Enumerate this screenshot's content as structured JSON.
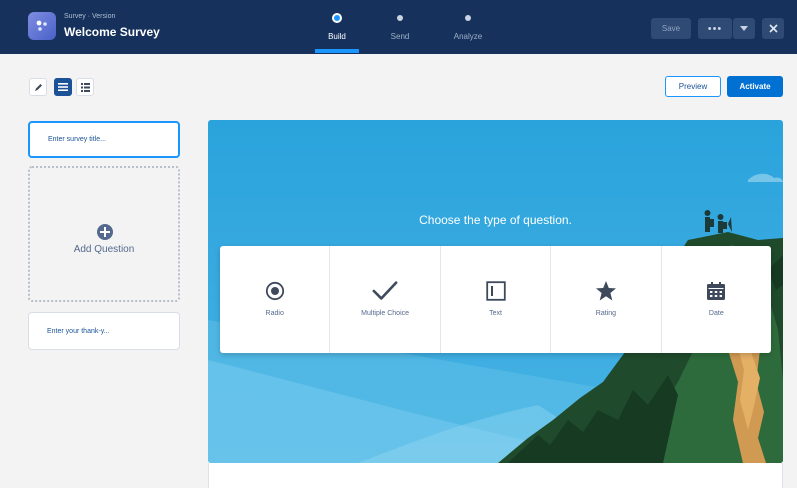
{
  "header": {
    "crumb": "Survey · Version",
    "title": "Welcome Survey",
    "steps": [
      {
        "label": "Build",
        "active": true
      },
      {
        "label": "Send",
        "active": false
      },
      {
        "label": "Analyze",
        "active": false
      }
    ],
    "save_label": "Save",
    "more_label": "•••"
  },
  "toolbar": {
    "tools": [
      "pencil-icon",
      "list-icon",
      "grid-icon"
    ],
    "preview_label": "Preview",
    "activate_label": "Activate"
  },
  "left_panel": {
    "title_placeholder": "Enter survey title...",
    "add_question_label": "Add Question",
    "thanks_placeholder": "Enter your thank-y..."
  },
  "canvas": {
    "prompt": "Choose the type of question.",
    "question_types": [
      {
        "label": "Radio",
        "icon": "radio-icon"
      },
      {
        "label": "Multiple Choice",
        "icon": "checkmark-icon"
      },
      {
        "label": "Text",
        "icon": "text-box-icon"
      },
      {
        "label": "Rating",
        "icon": "star-icon"
      },
      {
        "label": "Date",
        "icon": "calendar-icon"
      }
    ]
  },
  "colors": {
    "header_bg": "#16325c",
    "brand_blue": "#0070d2",
    "accent_blue": "#1b96ff",
    "icon_gray": "#54698d"
  }
}
